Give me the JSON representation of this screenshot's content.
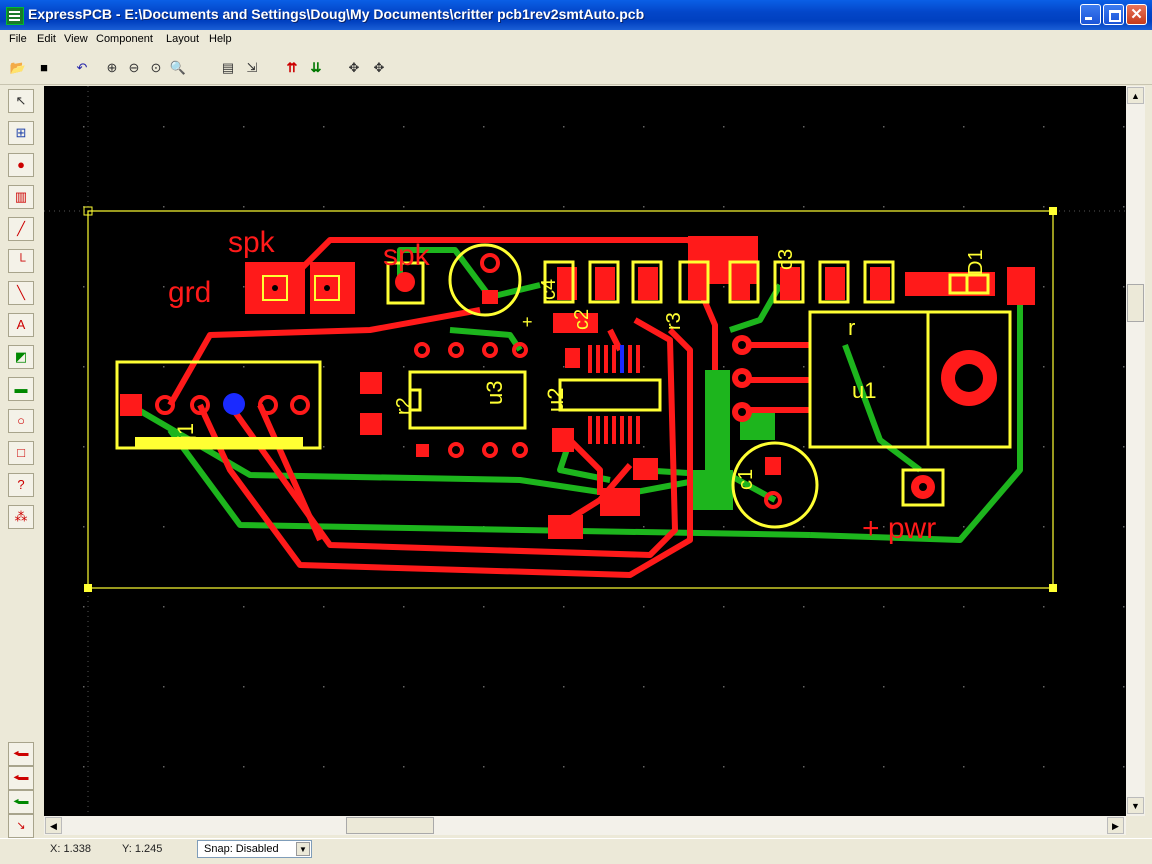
{
  "window": {
    "title": "ExpressPCB - E:\\Documents and Settings\\Doug\\My Documents\\critter pcb1rev2smtAuto.pcb"
  },
  "menu": [
    "File",
    "Edit",
    "View",
    "Component",
    "Layout",
    "Help"
  ],
  "toolbar_icons": [
    "open-icon",
    "save-icon",
    "undo-icon",
    "zoom-in-icon",
    "zoom-out-icon",
    "zoom-fit-icon",
    "zoom-area-icon",
    "properties-icon",
    "netlist-icon",
    "top-layer-icon",
    "bottom-layer-icon",
    "pan-icon",
    "center-icon"
  ],
  "palette_icons": [
    "select-arrow-icon",
    "zoom-select-icon",
    "place-pad-icon",
    "place-component-icon",
    "trace-icon",
    "rectangle-trace-icon",
    "diagonal-trace-icon",
    "text-icon",
    "filled-shape-icon",
    "ground-plane-icon",
    "circle-icon",
    "rectangle-icon",
    "query-icon",
    "connect-icon"
  ],
  "board": {
    "labels": {
      "spk1": "spk",
      "spk2": "spk",
      "grd": "grd",
      "pwr": "+ pwr",
      "c1": "c1",
      "c2": "c2",
      "c3": "c3",
      "c4": "c4",
      "u1": "u1",
      "u2": "u2",
      "u3": "u3",
      "j1": "j1",
      "r2": "r2",
      "r3": "r3",
      "r": "r",
      "D1": "D1",
      "plus": "+"
    },
    "colors": {
      "top": "#ff1a1a",
      "bottom": "#1db51d",
      "silk": "#ffff33",
      "bg": "#000000",
      "accent": "#1a2aff"
    }
  },
  "status": {
    "x": "X: 1.338",
    "y": "Y: 1.245",
    "snap": "Snap: Disabled"
  }
}
